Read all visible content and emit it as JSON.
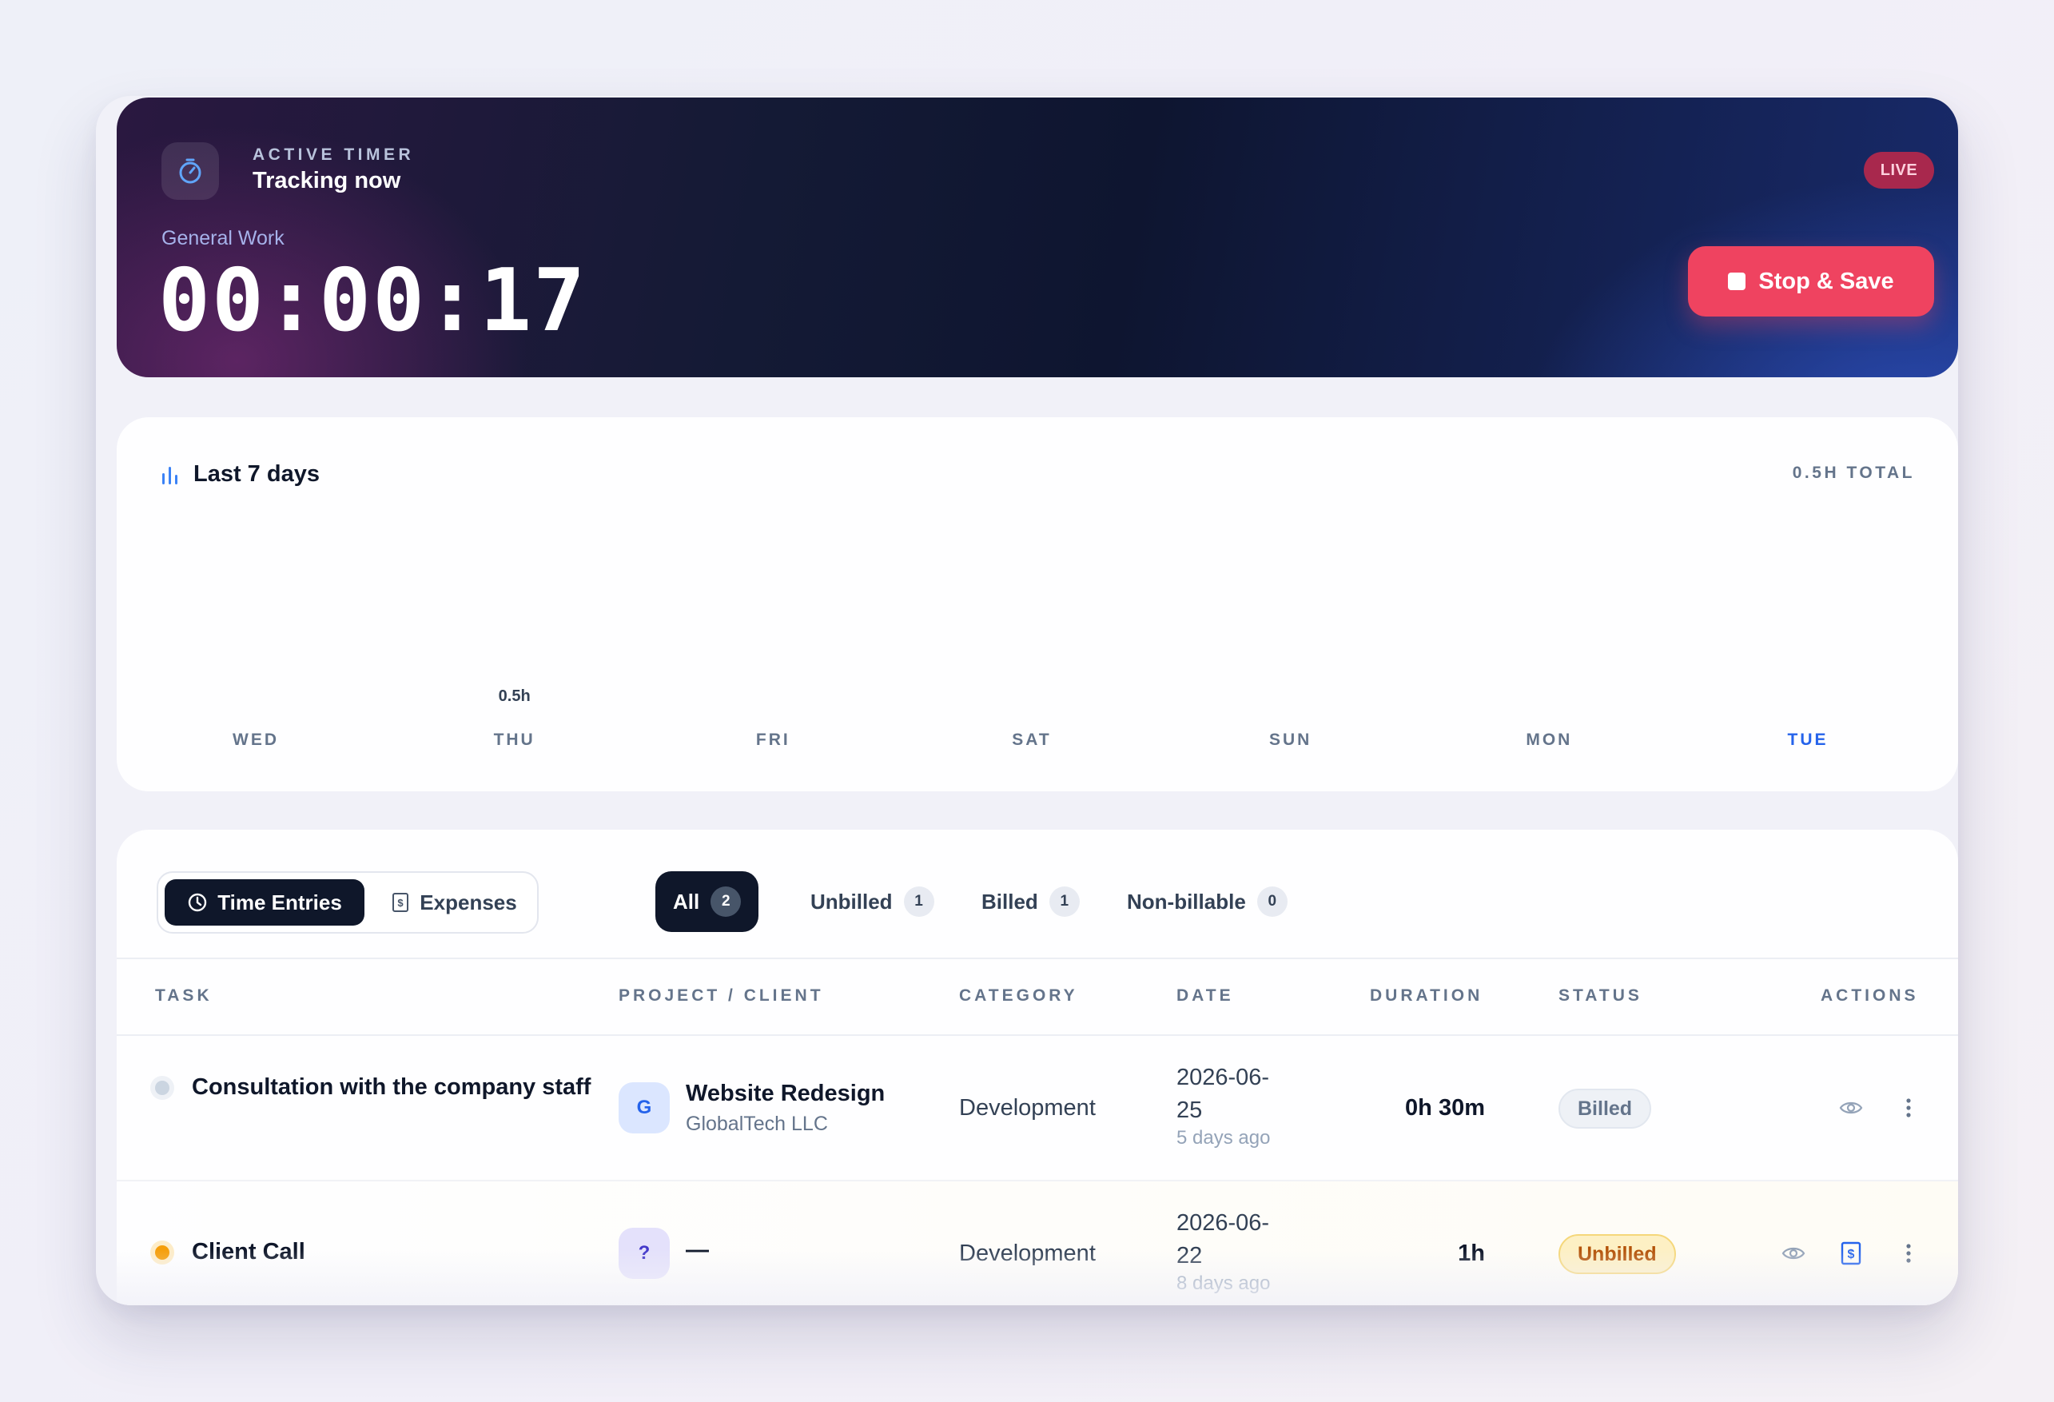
{
  "timer": {
    "eyebrow": "ACTIVE TIMER",
    "status_text": "Tracking now",
    "project_label": "General Work",
    "elapsed": "00:00:17",
    "live_badge": "LIVE",
    "stop_button": "Stop & Save",
    "icon": "stopwatch-icon"
  },
  "weekly": {
    "title": "Last 7 days",
    "total": "0.5H TOTAL",
    "icon": "bar-chart-icon",
    "days": [
      {
        "label": "WED",
        "value": ""
      },
      {
        "label": "THU",
        "value": "0.5h"
      },
      {
        "label": "FRI",
        "value": ""
      },
      {
        "label": "SAT",
        "value": ""
      },
      {
        "label": "SUN",
        "value": ""
      },
      {
        "label": "MON",
        "value": ""
      },
      {
        "label": "TUE",
        "value": ""
      }
    ],
    "today": "TUE"
  },
  "tabs": {
    "time_entries": "Time Entries",
    "expenses": "Expenses"
  },
  "filters": [
    {
      "label": "All",
      "count": "2"
    },
    {
      "label": "Unbilled",
      "count": "1"
    },
    {
      "label": "Billed",
      "count": "1"
    },
    {
      "label": "Non-billable",
      "count": "0"
    }
  ],
  "table": {
    "headers": {
      "task": "TASK",
      "project": "PROJECT / CLIENT",
      "category": "CATEGORY",
      "date": "DATE",
      "duration": "DURATION",
      "status": "STATUS",
      "actions": "ACTIONS"
    },
    "rows": [
      {
        "task": "Consultation with the company staff",
        "avatar": "G",
        "project": "Website Redesign",
        "client": "GlobalTech LLC",
        "category": "Development",
        "date": "2026-06-25",
        "ago": "5 days ago",
        "duration": "0h 30m",
        "status": "Billed"
      },
      {
        "task": "Client Call",
        "avatar": "?",
        "project": "—",
        "client": "",
        "category": "Development",
        "date": "2026-06-22",
        "ago": "8 days ago",
        "duration": "1h",
        "status": "Unbilled"
      }
    ]
  },
  "colors": {
    "accent": "#2563eb",
    "stop": "#ef4360",
    "dark": "#0f172a",
    "unbilled_dot": "#f59e0b",
    "billed_dot": "#cbd5e1"
  }
}
